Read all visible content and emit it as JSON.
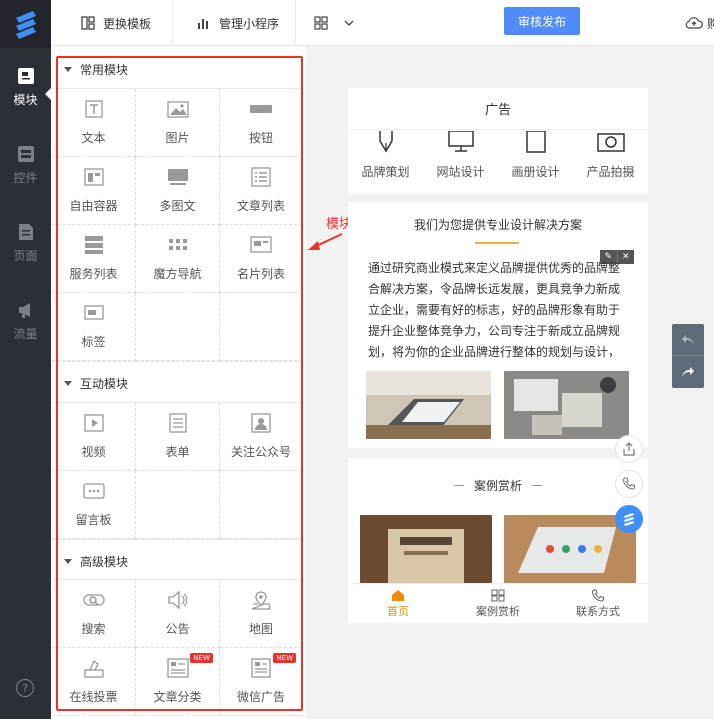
{
  "rail": {
    "items": [
      {
        "label": "模块",
        "icon": "module-icon",
        "active": true
      },
      {
        "label": "控件",
        "icon": "control-icon",
        "active": false
      },
      {
        "label": "页面",
        "icon": "page-icon",
        "active": false
      },
      {
        "label": "流量",
        "icon": "traffic-icon",
        "active": false
      }
    ],
    "help": "?"
  },
  "topbar": {
    "change_template": "更换模板",
    "manage_miniprogram": "管理小程序",
    "publish": "审核发布",
    "cloud_partial": "购"
  },
  "panel": {
    "sections": [
      {
        "title": "常用模块",
        "items": [
          {
            "label": "文本",
            "icon": "text-icon"
          },
          {
            "label": "图片",
            "icon": "image-icon"
          },
          {
            "label": "按钮",
            "icon": "button-icon"
          },
          {
            "label": "自由容器",
            "icon": "container-icon"
          },
          {
            "label": "多图文",
            "icon": "multi-image-text-icon"
          },
          {
            "label": "文章列表",
            "icon": "article-list-icon"
          },
          {
            "label": "服务列表",
            "icon": "service-list-icon"
          },
          {
            "label": "魔方导航",
            "icon": "grid-nav-icon"
          },
          {
            "label": "名片列表",
            "icon": "card-list-icon"
          },
          {
            "label": "标签",
            "icon": "tag-icon"
          }
        ]
      },
      {
        "title": "互动模块",
        "items": [
          {
            "label": "视频",
            "icon": "video-icon"
          },
          {
            "label": "表单",
            "icon": "form-icon"
          },
          {
            "label": "关注公众号",
            "icon": "follow-account-icon"
          },
          {
            "label": "留言板",
            "icon": "message-board-icon"
          }
        ]
      },
      {
        "title": "高级模块",
        "items": [
          {
            "label": "搜索",
            "icon": "search-icon"
          },
          {
            "label": "公告",
            "icon": "announcement-icon"
          },
          {
            "label": "地图",
            "icon": "map-icon"
          },
          {
            "label": "在线投票",
            "icon": "vote-icon"
          },
          {
            "label": "文章分类",
            "icon": "article-category-icon",
            "badge": "NEW"
          },
          {
            "label": "微信广告",
            "icon": "wechat-ad-icon",
            "badge": "NEW"
          }
        ]
      }
    ]
  },
  "annotation": {
    "label": "模块面板",
    "color": "#e8322b"
  },
  "preview": {
    "title": "广告",
    "services": [
      "品牌策划",
      "网站设计",
      "画册设计",
      "产品拍摄"
    ],
    "slogan": "我们为您提供专业设计解决方案",
    "paragraph": "通过研究商业模式来定义品牌提供优秀的品牌整合解决方案，令品牌长远发展，更具竞争力新成立企业，需要有好的标志，好的品牌形象有助于提升企业整体竞争力，公司专注于新成立品牌规划，将为你的企业品牌进行整体的规划与设计，努力为您打造强大品牌基础。",
    "case_title": "案例赏析",
    "nav": [
      {
        "label": "首页",
        "icon": "home-icon",
        "active": true
      },
      {
        "label": "案例赏析",
        "icon": "case-grid-icon",
        "active": false
      },
      {
        "label": "联系方式",
        "icon": "phone-icon",
        "active": false
      }
    ]
  },
  "colors": {
    "accent": "#4f8cf6",
    "annotation": "#e8322b",
    "active_nav": "#f08c00",
    "rail_bg": "#2b2f36"
  }
}
